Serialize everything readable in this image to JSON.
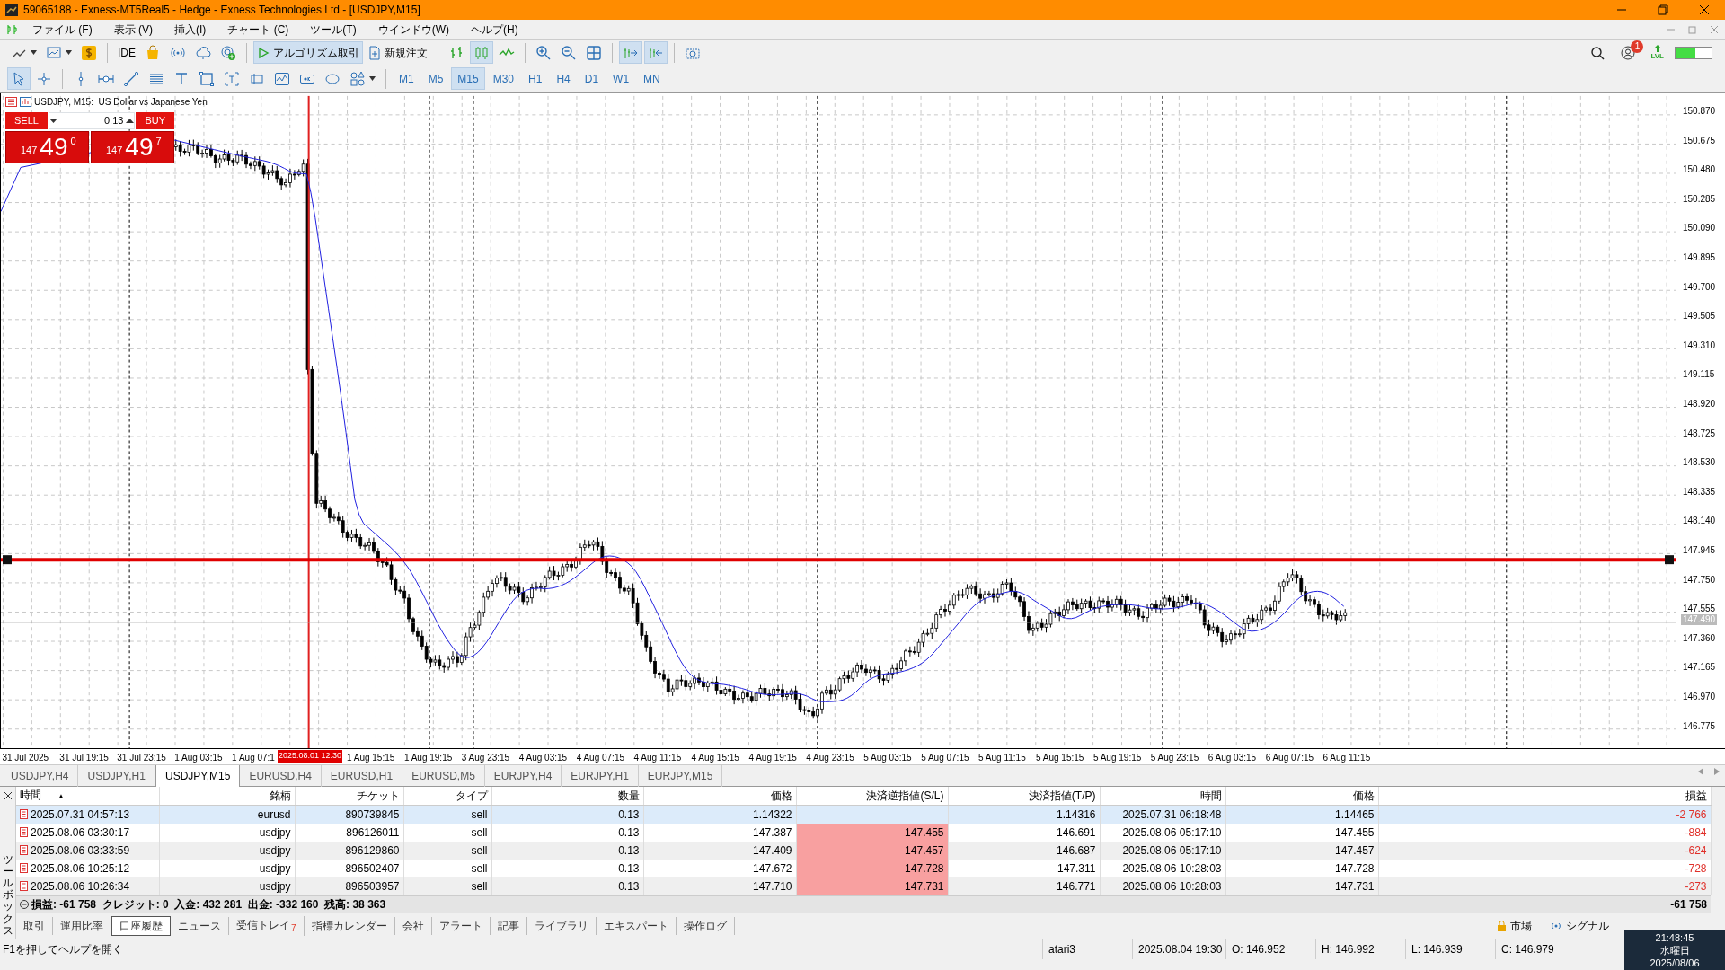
{
  "window": {
    "title": "59065188 - Exness-MT5Real5 - Hedge - Exness Technologies Ltd - [USDJPY,M15]"
  },
  "menu": [
    "ファイル (F)",
    "表示 (V)",
    "挿入(I)",
    "チャート (C)",
    "ツール(T)",
    "ウインドウ(W)",
    "ヘルプ(H)"
  ],
  "toolbar": {
    "ide": "IDE",
    "algo_trading": {
      "label": "アルゴリズム取引",
      "on": true
    },
    "new_order": "新規注文",
    "notification_count": "1",
    "level_badge": "LVL"
  },
  "timeframes": [
    {
      "label": "M1",
      "selected": false
    },
    {
      "label": "M5",
      "selected": false
    },
    {
      "label": "M15",
      "selected": true
    },
    {
      "label": "M30",
      "selected": false
    },
    {
      "label": "H1",
      "selected": false
    },
    {
      "label": "H4",
      "selected": false
    },
    {
      "label": "D1",
      "selected": false
    },
    {
      "label": "W1",
      "selected": false
    },
    {
      "label": "MN",
      "selected": false
    }
  ],
  "chart": {
    "title": "USDJPY, M15:  US Dollar vs Japanese Yen",
    "trade_panel": {
      "sell_label": "SELL",
      "buy_label": "BUY",
      "volume": "0.13",
      "sell_price": {
        "big": "147",
        "main": "49",
        "small": "0"
      },
      "buy_price": {
        "big": "147",
        "main": "49",
        "small": "7"
      }
    },
    "price_labels": [
      "150.870",
      "150.675",
      "150.480",
      "150.285",
      "150.090",
      "149.895",
      "149.700",
      "149.505",
      "149.310",
      "149.115",
      "148.920",
      "148.725",
      "148.530",
      "148.335",
      "148.140",
      "147.945",
      "147.750",
      "147.555",
      "147.360",
      "147.165",
      "146.970",
      "146.775"
    ],
    "current_price": "147.490",
    "time_labels": [
      "31 Jul 2025",
      "31 Jul 19:15",
      "31 Jul 23:15",
      "1 Aug 03:15",
      "1 Aug 07:1",
      "1 Aug 15:15",
      "1 Aug 19:15",
      "3 Aug 23:15",
      "4 Aug 03:15",
      "4 Aug 07:15",
      "4 Aug 11:15",
      "4 Aug 15:15",
      "4 Aug 19:15",
      "4 Aug 23:15",
      "5 Aug 03:15",
      "5 Aug 07:15",
      "5 Aug 11:15",
      "5 Aug 15:15",
      "5 Aug 19:15",
      "5 Aug 23:15",
      "6 Aug 03:15",
      "6 Aug 07:15",
      "6 Aug 11:15"
    ],
    "cursor_time": "2025.08.01 12:30"
  },
  "chart_tabs": [
    {
      "label": "USDJPY,H4",
      "selected": false
    },
    {
      "label": "USDJPY,H1",
      "selected": false
    },
    {
      "label": "USDJPY,M15",
      "selected": true
    },
    {
      "label": "EURUSD,H4",
      "selected": false
    },
    {
      "label": "EURUSD,H1",
      "selected": false
    },
    {
      "label": "EURUSD,M5",
      "selected": false
    },
    {
      "label": "EURJPY,H4",
      "selected": false
    },
    {
      "label": "EURJPY,H1",
      "selected": false
    },
    {
      "label": "EURJPY,M15",
      "selected": false
    }
  ],
  "toolbox": {
    "label": "ツールボックス",
    "table": {
      "columns": [
        {
          "label": "時間",
          "sort_mark": "▲"
        },
        {
          "label": "銘柄"
        },
        {
          "label": "チケット"
        },
        {
          "label": "タイプ"
        },
        {
          "label": "数量"
        },
        {
          "label": "価格"
        },
        {
          "label": "決済逆指値(S/L)"
        },
        {
          "label": "決済指値(T/P)"
        },
        {
          "label": "時間"
        },
        {
          "label": "価格"
        },
        {
          "label": "損益"
        }
      ],
      "rows": [
        {
          "selected": true,
          "sl_highlighted": false,
          "cells": [
            "2025.07.31 04:57:13",
            "eurusd",
            "890739845",
            "sell",
            "0.13",
            "1.14322",
            null,
            "1.14316",
            "2025.07.31 06:18:48",
            "1.14465",
            "-2 766"
          ]
        },
        {
          "selected": false,
          "sl_highlighted": true,
          "cells": [
            "2025.08.06 03:30:17",
            "usdjpy",
            "896126011",
            "sell",
            "0.13",
            "147.387",
            "147.455",
            "146.691",
            "2025.08.06 05:17:10",
            "147.455",
            "-884"
          ]
        },
        {
          "selected": false,
          "sl_highlighted": true,
          "cells": [
            "2025.08.06 03:33:59",
            "usdjpy",
            "896129860",
            "sell",
            "0.13",
            "147.409",
            "147.457",
            "146.687",
            "2025.08.06 05:17:10",
            "147.457",
            "-624"
          ]
        },
        {
          "selected": false,
          "sl_highlighted": true,
          "cells": [
            "2025.08.06 10:25:12",
            "usdjpy",
            "896502407",
            "sell",
            "0.13",
            "147.672",
            "147.728",
            "147.311",
            "2025.08.06 10:28:03",
            "147.728",
            "-728"
          ]
        },
        {
          "selected": false,
          "sl_highlighted": true,
          "cells": [
            "2025.08.06 10:26:34",
            "usdjpy",
            "896503957",
            "sell",
            "0.13",
            "147.710",
            "147.731",
            "146.771",
            "2025.08.06 10:28:03",
            "147.731",
            "-273"
          ]
        }
      ],
      "summary": "損益: -61 758  クレジット: 0  入金: 432 281  出金: -332 160  残高: 38 363",
      "total": "-61 758"
    },
    "tabs": [
      {
        "label": "取引",
        "selected": false
      },
      {
        "label": "運用比率",
        "selected": false
      },
      {
        "label": "口座履歴",
        "selected": true
      },
      {
        "label": "ニュース",
        "selected": false
      },
      {
        "label": "受信トレイ",
        "selected": false,
        "badge": "7"
      },
      {
        "label": "指標カレンダー",
        "selected": false
      },
      {
        "label": "会社",
        "selected": false
      },
      {
        "label": "アラート",
        "selected": false
      },
      {
        "label": "記事",
        "selected": false
      },
      {
        "label": "ライブラリ",
        "selected": false
      },
      {
        "label": "エキスパート",
        "selected": false
      },
      {
        "label": "操作ログ",
        "selected": false
      }
    ],
    "market": "市場",
    "signals": "シグナル"
  },
  "status_bar": {
    "help": "F1を押してヘルプを開く",
    "profile": "atari3",
    "datetime": "2025.08.04 19:30",
    "open": "O: 146.952",
    "high": "H: 146.992",
    "low": "L: 146.939",
    "close": "C: 146.979"
  },
  "clock": {
    "time": "21:48:45",
    "day": "水曜日",
    "date": "2025/08/06"
  }
}
